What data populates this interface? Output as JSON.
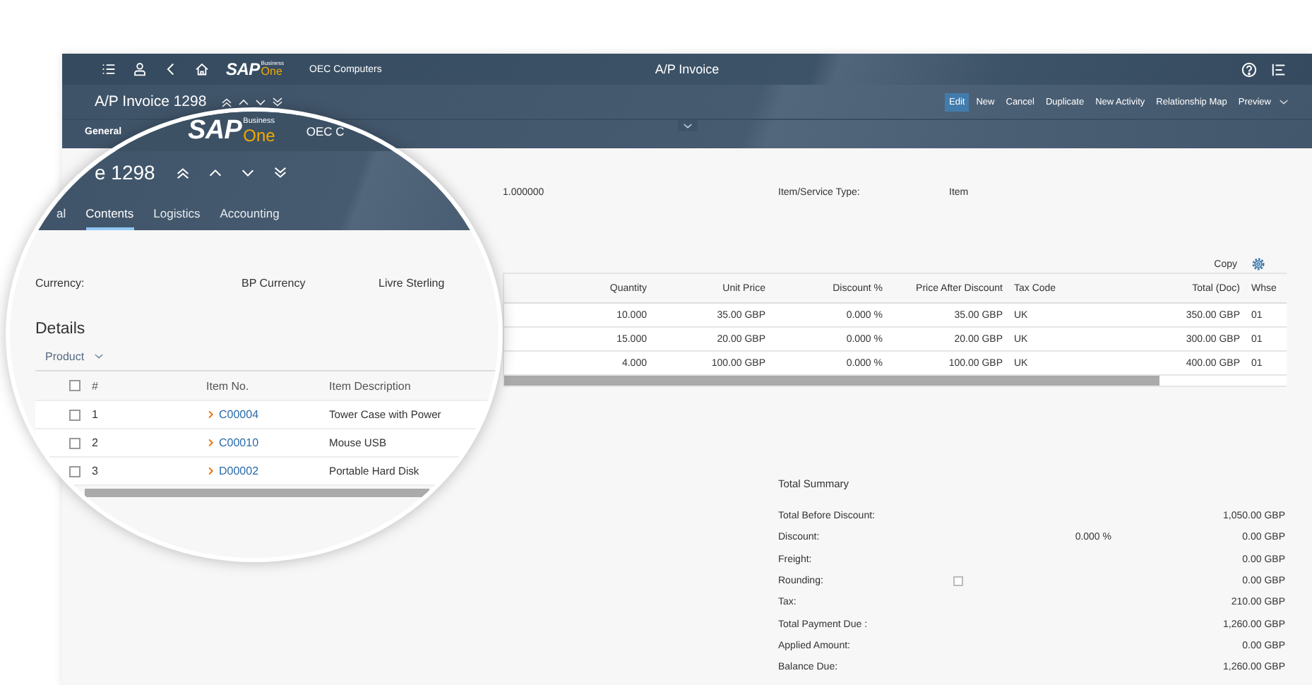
{
  "shell": {
    "logo": {
      "brand": "SAP",
      "line_1": "Business",
      "line_2": "One"
    },
    "company": "OEC Computers",
    "title": "A/P Invoice"
  },
  "header": {
    "title": "A/P Invoice 1298",
    "actions": [
      {
        "label": "Edit",
        "selected": true
      },
      {
        "label": "New",
        "selected": false
      },
      {
        "label": "Cancel",
        "selected": false
      },
      {
        "label": "Duplicate",
        "selected": false
      },
      {
        "label": "New Activity",
        "selected": false
      },
      {
        "label": "Relationship Map",
        "selected": false
      },
      {
        "label": "Preview",
        "selected": false
      }
    ],
    "tabs": [
      "General"
    ]
  },
  "fields": {
    "rate": "1.000000",
    "type_label": "Item/Service Type:",
    "type_value": "Item"
  },
  "table": {
    "toolbar": "Copy",
    "columns": [
      "Quantity",
      "Unit Price",
      "Discount %",
      "Price After Discount",
      "Tax Code",
      "Total (Doc)",
      "Whse"
    ],
    "rows": [
      [
        "10.000",
        "35.00 GBP",
        "0.000 %",
        "35.00 GBP",
        "UK",
        "350.00 GBP",
        "01"
      ],
      [
        "15.000",
        "20.00 GBP",
        "0.000 %",
        "20.00 GBP",
        "UK",
        "300.00 GBP",
        "01"
      ],
      [
        "4.000",
        "100.00 GBP",
        "0.000 %",
        "100.00 GBP",
        "UK",
        "400.00 GBP",
        "01"
      ]
    ]
  },
  "summary": {
    "title": "Total Summary",
    "rows": [
      {
        "kind": "amount",
        "label": "Total Before Discount:",
        "value": "1,050.00 GBP"
      },
      {
        "kind": "percent",
        "label": "Discount:",
        "rate": "0.000 %",
        "value": "0.00 GBP"
      },
      {
        "kind": "amount",
        "label": "Freight:",
        "value": "0.00 GBP"
      },
      {
        "kind": "checkbox",
        "label": "Rounding:",
        "checked": false,
        "value": "0.00 GBP"
      },
      {
        "kind": "amount",
        "label": "Tax:",
        "value": "210.00 GBP"
      },
      {
        "kind": "amount",
        "label": "Total Payment Due :",
        "value": "1,260.00 GBP"
      },
      {
        "kind": "amount",
        "label": "Applied Amount:",
        "value": "0.00 GBP"
      },
      {
        "kind": "amount",
        "label": "Balance Due:",
        "value": "1,260.00 GBP"
      }
    ]
  },
  "magnifier": {
    "logo": {
      "brand": "SAP",
      "line_1": "Business",
      "line_2": "One"
    },
    "company": "OEC C",
    "title": "e 1298",
    "tabs": [
      {
        "label": "al",
        "selected": false
      },
      {
        "label": "Contents",
        "selected": true
      },
      {
        "label": "Logistics",
        "selected": false
      },
      {
        "label": "Accounting",
        "selected": false
      }
    ],
    "currency": {
      "label": "Currency:",
      "option": "BP Currency",
      "value": "Livre Sterling"
    },
    "section": "Details",
    "view": "Product",
    "select_all": {
      "checked": false
    },
    "columns": [
      "#",
      "Item No.",
      "Item Description"
    ],
    "rows": [
      {
        "checked": false,
        "number": "1",
        "item_no": "C00004",
        "description": "Tower Case with Power"
      },
      {
        "checked": false,
        "number": "2",
        "item_no": "C00010",
        "description": "Mouse USB"
      },
      {
        "checked": false,
        "number": "3",
        "item_no": "D00002",
        "description": "Portable Hard Disk"
      }
    ]
  }
}
